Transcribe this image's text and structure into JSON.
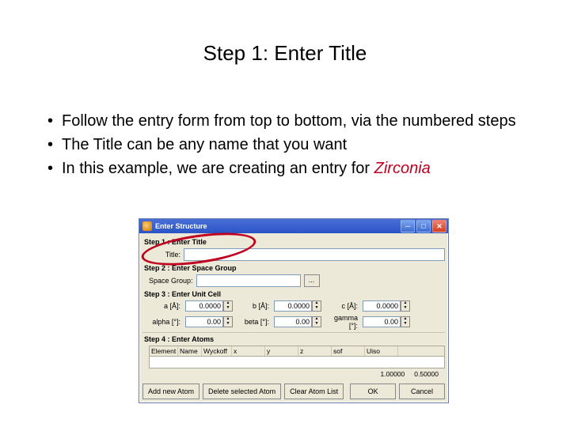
{
  "slide": {
    "title": "Step 1: Enter Title",
    "bullets": [
      "Follow the entry form from top to bottom, via the numbered steps",
      "The Title can be any name that you want"
    ],
    "bullet3_prefix": "In this example, we are creating an entry for ",
    "bullet3_em": "Zirconia"
  },
  "window": {
    "title": "Enter Structure",
    "step1": {
      "label": "Step 1 : Enter Title",
      "field_label": "Title:"
    },
    "step2": {
      "label": "Step 2 : Enter Space Group",
      "field_label": "Space Group:",
      "browse": "..."
    },
    "step3": {
      "label": "Step 3 : Enter Unit Cell",
      "rows": [
        {
          "l1": "a [Å]:",
          "v1": "0.0000",
          "l2": "b [Å]:",
          "v2": "0.0000",
          "l3": "c [Å]:",
          "v3": "0.0000"
        },
        {
          "l1": "alpha [°]:",
          "v1": "0.00",
          "l2": "beta [°]:",
          "v2": "0.00",
          "l3": "gamma [°]:",
          "v3": "0.00"
        }
      ]
    },
    "step4": {
      "label": "Step 4 : Enter Atoms",
      "columns": [
        "Element",
        "Name",
        "Wyckoff",
        "x",
        "y",
        "z",
        "sof",
        "Uiso"
      ],
      "defaults": {
        "sof": "1.00000",
        "uiso": "0.50000"
      }
    },
    "buttons": {
      "add": "Add new Atom",
      "del": "Delete selected Atom",
      "clear": "Clear Atom List",
      "ok": "OK",
      "cancel": "Cancel"
    }
  }
}
